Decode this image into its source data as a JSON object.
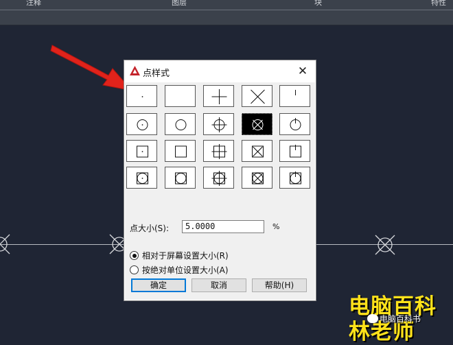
{
  "ribbon": {
    "items": [
      "注释",
      "图层",
      "块",
      "特性"
    ]
  },
  "dialog": {
    "title": "点样式",
    "close_label": "✕",
    "styles": [
      {
        "row": 0,
        "col": 0,
        "shape": "dot"
      },
      {
        "row": 0,
        "col": 1,
        "shape": "none"
      },
      {
        "row": 0,
        "col": 2,
        "shape": "plus"
      },
      {
        "row": 0,
        "col": 3,
        "shape": "x"
      },
      {
        "row": 0,
        "col": 4,
        "shape": "tick"
      },
      {
        "row": 1,
        "col": 0,
        "shape": "circle-dot"
      },
      {
        "row": 1,
        "col": 1,
        "shape": "circle"
      },
      {
        "row": 1,
        "col": 2,
        "shape": "circle-plus"
      },
      {
        "row": 1,
        "col": 3,
        "shape": "circle-x",
        "selected": true
      },
      {
        "row": 1,
        "col": 4,
        "shape": "circle-tick"
      },
      {
        "row": 2,
        "col": 0,
        "shape": "square-dot"
      },
      {
        "row": 2,
        "col": 1,
        "shape": "square"
      },
      {
        "row": 2,
        "col": 2,
        "shape": "square-plus"
      },
      {
        "row": 2,
        "col": 3,
        "shape": "square-x"
      },
      {
        "row": 2,
        "col": 4,
        "shape": "square-tick"
      },
      {
        "row": 3,
        "col": 0,
        "shape": "circle-square-dot"
      },
      {
        "row": 3,
        "col": 1,
        "shape": "circle-square"
      },
      {
        "row": 3,
        "col": 2,
        "shape": "circle-square-plus"
      },
      {
        "row": 3,
        "col": 3,
        "shape": "circle-square-x"
      },
      {
        "row": 3,
        "col": 4,
        "shape": "circle-square-tick"
      }
    ],
    "size_label": "点大小(S):",
    "size_value": "5.0000",
    "size_unit": "%",
    "radio_relative": "相对于屏幕设置大小(R)",
    "radio_absolute": "按绝对单位设置大小(A)",
    "relative_selected": true,
    "ok_label": "确定",
    "cancel_label": "取消",
    "help_label": "帮助(H)"
  },
  "watermark": {
    "line1": "电脑百科",
    "line2": "林老师",
    "account": "电脑百科书"
  },
  "colors": {
    "canvas": "#1f2534",
    "arrow": "#e0231b",
    "watermark_text": "#ffe21a",
    "accent": "#0078d7"
  },
  "icons": [
    "autocad-app-icon",
    "close-icon",
    "red-arrow-icon",
    "cad-point-x-circle-icon",
    "wechat-icon"
  ]
}
